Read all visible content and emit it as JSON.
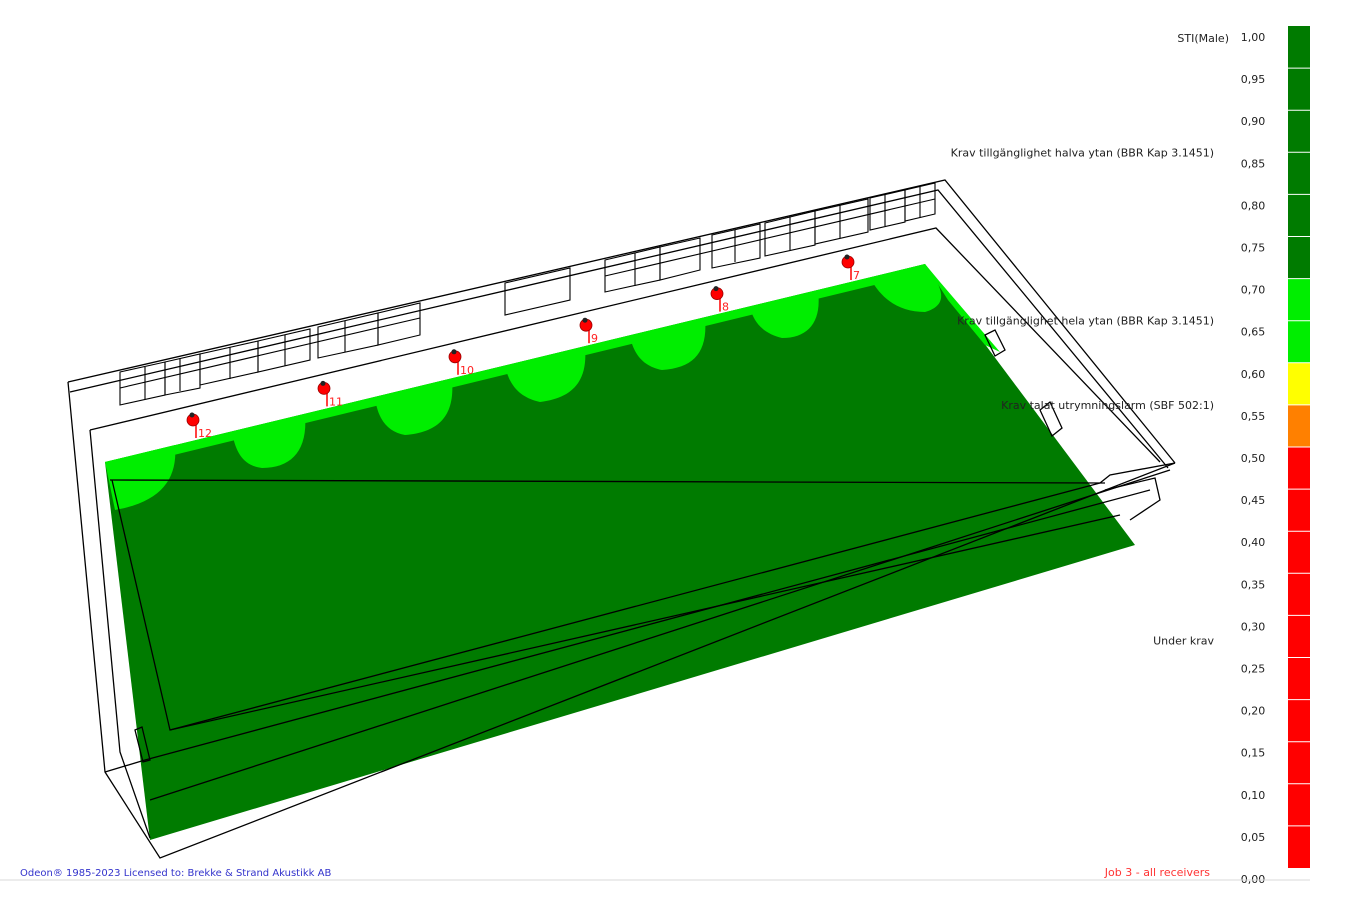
{
  "scale": {
    "title": "STI(Male)",
    "ticks": [
      "1,00",
      "0,95",
      "0,90",
      "0,85",
      "0,80",
      "0,75",
      "0,70",
      "0,65",
      "0,60",
      "0,55",
      "0,50",
      "0,45",
      "0,40",
      "0,35",
      "0,30",
      "0,25",
      "0,20",
      "0,15",
      "0,10",
      "0,05",
      "0,00"
    ],
    "bands": [
      {
        "from": 0.7,
        "to": 1.0,
        "color": "#007b00"
      },
      {
        "from": 0.6,
        "to": 0.7,
        "color": "#00ee00"
      },
      {
        "from": 0.55,
        "to": 0.6,
        "color": "#ffff00"
      },
      {
        "from": 0.5,
        "to": 0.55,
        "color": "#ff8000"
      },
      {
        "from": 0.0,
        "to": 0.5,
        "color": "#ff0000"
      }
    ],
    "requirements": [
      {
        "label": "Krav tillgänglighet halva ytan (BBR Kap 3.1451)",
        "value": 0.85
      },
      {
        "label": "Krav tillgänglighet hela ytan (BBR Kap 3.1451)",
        "value": 0.65
      },
      {
        "label": "Krav talat utrymningslarm (SBF 502:1)",
        "value": 0.55
      },
      {
        "label": "Under krav",
        "value": 0.27
      }
    ]
  },
  "receivers": [
    "12",
    "11",
    "10",
    "9",
    "8",
    "7"
  ],
  "footer": {
    "copyright": "Odeon® 1985-2023   Licensed to: Brekke & Strand Akustikk AB",
    "job": "Job 3 - all receivers"
  },
  "colors": {
    "dark_green": "#007b00",
    "light_green": "#00ee00",
    "receiver": "#ff0000",
    "footer_left": "#3333cc",
    "footer_right": "#ff3333"
  }
}
